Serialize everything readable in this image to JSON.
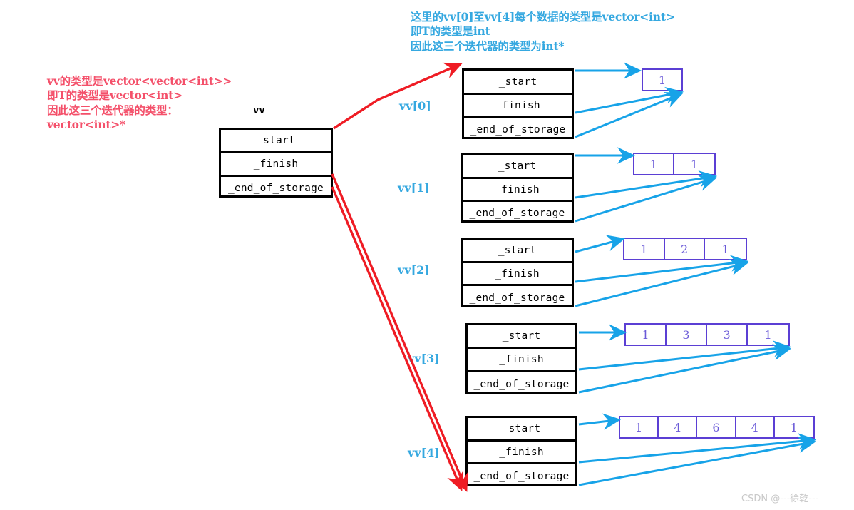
{
  "annotations": {
    "left_red": "vv的类型是vector<vector<int>>\n即T的类型是vector<int>\n因此这三个迭代器的类型：\nvector<int>*",
    "top_cyan": "这里的vv[0]至vv[4]每个数据的类型是vector<int>\n即T的类型是int\n因此这三个迭代器的类型为int*"
  },
  "colors": {
    "red": "#f4506a",
    "red_arrow": "#ef1c24",
    "cyan": "#35a8e0",
    "purple_border": "#5b3fd4",
    "purple_text": "#6b5bd8",
    "black": "#000000",
    "watermark": "#c9c9c9"
  },
  "master": {
    "title": "vv",
    "fields": [
      "_start",
      "_finish",
      "_end_of_storage"
    ]
  },
  "rows": [
    {
      "label": "vv[0]",
      "fields": [
        "_start",
        "_finish",
        "_end_of_storage"
      ],
      "values": [
        "1"
      ]
    },
    {
      "label": "vv[1]",
      "fields": [
        "_start",
        "_finish",
        "_end_of_storage"
      ],
      "values": [
        "1",
        "1"
      ]
    },
    {
      "label": "vv[2]",
      "fields": [
        "_start",
        "_finish",
        "_end_of_storage"
      ],
      "values": [
        "1",
        "2",
        "1"
      ]
    },
    {
      "label": "vv[3]",
      "fields": [
        "_start",
        "_finish",
        "_end_of_storage"
      ],
      "values": [
        "1",
        "3",
        "3",
        "1"
      ]
    },
    {
      "label": "vv[4]",
      "fields": [
        "_start",
        "_finish",
        "_end_of_storage"
      ],
      "values": [
        "1",
        "4",
        "6",
        "4",
        "1"
      ]
    }
  ],
  "watermark": "CSDN @---徐乾---"
}
